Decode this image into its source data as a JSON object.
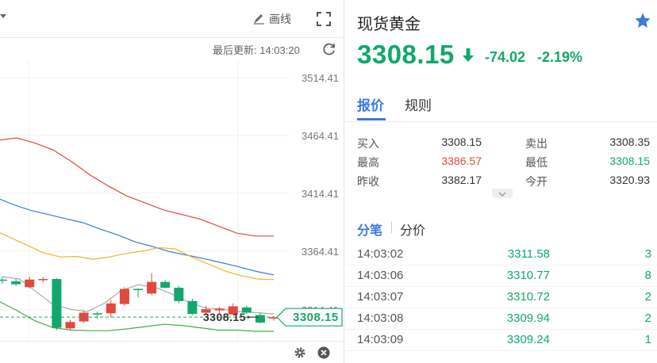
{
  "chart": {
    "draw_label": "画线",
    "last_update": "最后更新: 14:03:20",
    "y_labels": [
      "3514.41",
      "3464.41",
      "3414.41",
      "3364.41",
      "3314.41"
    ],
    "last_price_tag": "3308.15",
    "crosshair_label": "3308.15",
    "colors": {
      "up": "#e2483d",
      "down": "#12a86b",
      "ma_red": "#e2483d",
      "ma_blue": "#3d7bd9",
      "ma_yellow": "#f2b51e",
      "ma_gray": "#aaaaaa",
      "ma_green": "#4aa84a"
    },
    "candles": [
      {
        "o": 3340.5,
        "h": 3343.0,
        "l": 3337.0,
        "c": 3339.5
      },
      {
        "o": 3339.0,
        "h": 3341.0,
        "l": 3335.0,
        "c": 3336.5
      },
      {
        "o": 3334.0,
        "h": 3343.0,
        "l": 3333.0,
        "c": 3340.5
      },
      {
        "o": 3340.5,
        "h": 3342.5,
        "l": 3338.0,
        "c": 3341.0
      },
      {
        "o": 3341.0,
        "h": 3342.0,
        "l": 3297.0,
        "c": 3299.0
      },
      {
        "o": 3298.5,
        "h": 3306.0,
        "l": 3297.0,
        "c": 3304.0
      },
      {
        "o": 3304.5,
        "h": 3313.5,
        "l": 3303.0,
        "c": 3312.0
      },
      {
        "o": 3311.5,
        "h": 3313.0,
        "l": 3307.0,
        "c": 3311.0
      },
      {
        "o": 3311.5,
        "h": 3323.0,
        "l": 3308.0,
        "c": 3320.0
      },
      {
        "o": 3319.5,
        "h": 3334.0,
        "l": 3318.0,
        "c": 3332.5
      },
      {
        "o": 3332.5,
        "h": 3333.0,
        "l": 3325.0,
        "c": 3332.0
      },
      {
        "o": 3328.5,
        "h": 3346.0,
        "l": 3327.0,
        "c": 3338.5
      },
      {
        "o": 3338.5,
        "h": 3340.0,
        "l": 3333.0,
        "c": 3333.5
      },
      {
        "o": 3333.5,
        "h": 3335.0,
        "l": 3320.0,
        "c": 3322.0
      },
      {
        "o": 3322.0,
        "h": 3324.0,
        "l": 3310.0,
        "c": 3311.0
      },
      {
        "o": 3312.0,
        "h": 3318.0,
        "l": 3311.0,
        "c": 3315.0
      },
      {
        "o": 3314.0,
        "h": 3317.0,
        "l": 3311.0,
        "c": 3315.5
      },
      {
        "o": 3310.5,
        "h": 3320.0,
        "l": 3310.0,
        "c": 3317.5
      },
      {
        "o": 3316.5,
        "h": 3318.0,
        "l": 3311.0,
        "c": 3312.0
      },
      {
        "o": 3310.0,
        "h": 3312.0,
        "l": 3303.0,
        "c": 3303.5
      },
      {
        "o": 3307.0,
        "h": 3309.0,
        "l": 3305.0,
        "c": 3308.15
      }
    ],
    "ma_red": [
      3469.5,
      3466.0,
      3460.5,
      3462.5,
      3458.0,
      3452.0,
      3442.0,
      3430.5,
      3421.0,
      3412.5,
      3406.5,
      3400.5,
      3396.5,
      3392.5,
      3386.5,
      3380.5,
      3378.0,
      3378.0
    ],
    "ma_blue": [
      3423.5,
      3417.5,
      3411.0,
      3405.0,
      3400.0,
      3396.5,
      3393.0,
      3389.5,
      3384.0,
      3379.0,
      3373.0,
      3369.0,
      3364.5,
      3361.5,
      3358.5,
      3355.0,
      3351.5,
      3347.5,
      3344.5
    ],
    "ma_yellow": [
      3391.5,
      3385.5,
      3383.0,
      3376.5,
      3370.0,
      3363.5,
      3360.0,
      3360.5,
      3358.0,
      3360.0,
      3363.0,
      3365.0,
      3368.0,
      3367.0,
      3360.0,
      3354.0,
      3348.0,
      3344.0,
      3341.0,
      3340.5
    ],
    "ma_gray": [
      3343.0,
      3341.0,
      3330.0,
      3319.0,
      3315.0,
      3313.0,
      3320.0,
      3331.0,
      3336.0,
      3334.0,
      3328.0,
      3321.0,
      3316.0,
      3315.0,
      3313.0,
      3312.0,
      3311.0
    ],
    "ma_green": [
      3333.0,
      3330.0,
      3322.0,
      3314.0,
      3305.0,
      3299.0,
      3297.0,
      3296.5,
      3296.5,
      3298.0,
      3300.0,
      3302.0,
      3301.0,
      3299.0,
      3297.0,
      3297.0,
      3296.0,
      3296.0
    ]
  },
  "quote": {
    "name": "现货黄金",
    "price": "3308.15",
    "change": "-74.02",
    "change_pct": "-2.19%",
    "tabs": {
      "quote": "报价",
      "rules": "规则"
    },
    "rows": [
      {
        "l1": "买入",
        "v1": "3308.15",
        "l2": "卖出",
        "v2": "3308.35"
      },
      {
        "l1": "最高",
        "v1": "3386.57",
        "l2": "最低",
        "v2": "3308.15"
      },
      {
        "l1": "昨收",
        "v1": "3382.17",
        "l2": "今开",
        "v2": "3320.93"
      }
    ],
    "trade_tabs": {
      "tick": "分笔",
      "price_dist": "分价"
    },
    "ticks": [
      {
        "time": "14:03:02",
        "price": "3311.58",
        "vol": "3"
      },
      {
        "time": "14:03:06",
        "price": "3310.77",
        "vol": "8"
      },
      {
        "time": "14:03:07",
        "price": "3310.72",
        "vol": "2"
      },
      {
        "time": "14:03:08",
        "price": "3309.94",
        "vol": "2"
      },
      {
        "time": "14:03:09",
        "price": "3309.24",
        "vol": "1"
      }
    ]
  }
}
